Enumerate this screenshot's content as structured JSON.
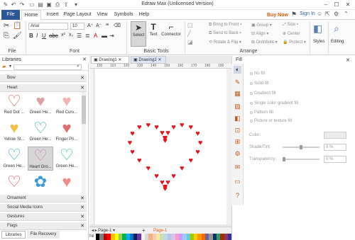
{
  "window": {
    "title": "Edraw Max (Unlicensed Version)"
  },
  "quickaccess": {
    "icons": [
      "undo-icon",
      "redo-icon",
      "new-icon",
      "open-icon",
      "save-icon",
      "print-icon",
      "export-icon"
    ]
  },
  "tabs": [
    "File",
    "Home",
    "Insert",
    "Page Layout",
    "View",
    "Symbols",
    "Help"
  ],
  "topright": {
    "buy_now": "Buy Now",
    "sign_in": "Sign In"
  },
  "ribbon": {
    "groups": {
      "file": "File",
      "font": "Font",
      "basic_tools": "Basic Tools",
      "arrange": "Arrange",
      "styles": "Styles",
      "editing": "Editing"
    },
    "font_name": "Arial",
    "font_size": "10",
    "tools": {
      "select": "Select",
      "text": "Text",
      "connector": "Connector"
    },
    "arrange": {
      "bring_to_front": "Bring to Front",
      "send_to_back": "Send to Back",
      "rotate_flip": "Rotate & Flip",
      "group": "Group",
      "align": "Align",
      "distribute": "Distribute",
      "size": "Size",
      "center": "Center",
      "protect": "Protect"
    }
  },
  "libraries": {
    "title": "Libraries",
    "categories": [
      "Bow",
      "Heart"
    ],
    "shapes": [
      {
        "label": "Red Dot ...",
        "glyph": "♡",
        "color": "#e85b5b"
      },
      {
        "label": "Green He...",
        "glyph": "♥",
        "color": "#e0a0a8"
      },
      {
        "label": "Red Curv...",
        "glyph": "♥",
        "color": "#f2b3b3"
      },
      {
        "label": "Yellow St...",
        "glyph": "♥",
        "color": "#f0c04a"
      },
      {
        "label": "Green He...",
        "glyph": "♡",
        "color": "#3bb0a0"
      },
      {
        "label": "Finger Pri...",
        "glyph": "♥",
        "color": "#e06a6a"
      },
      {
        "label": "Green He...",
        "glyph": "♡",
        "color": "#3aa5c8"
      },
      {
        "label": "Heart Gro...",
        "glyph": "♡",
        "color": "#d080b0"
      },
      {
        "label": "Green He...",
        "glyph": "♡",
        "color": "#30b8a8"
      },
      {
        "label": "",
        "glyph": "♡",
        "color": "#e04a5a"
      },
      {
        "label": "",
        "glyph": "✿",
        "color": "#3a9ad8"
      },
      {
        "label": "",
        "glyph": "♥",
        "color": "#f08a8a"
      }
    ],
    "bottom_categories": [
      "Ornament",
      "Social Media Icons",
      "Gestures",
      "Flags"
    ],
    "bottom_tabs": [
      "Libraries",
      "File Recovery"
    ]
  },
  "documents": {
    "tabs": [
      "Drawing1",
      "Drawing2"
    ],
    "ruler_marks": [
      "100",
      "110",
      "120",
      "130",
      "140",
      "150",
      "160",
      "170",
      "180",
      "190"
    ]
  },
  "pages": {
    "current": "Page-1",
    "active": "Page-1",
    "fill_label": "Fill"
  },
  "fill_panel": {
    "title": "Fill",
    "options": [
      "No fill",
      "Solid fill",
      "Gradient fill",
      "Single color gradient fill",
      "Pattern fill",
      "Picture or texture fill"
    ],
    "color_label": "Color:",
    "shade_label": "Shade/Tint:",
    "shade_value": "0 %",
    "transparency_label": "Transparency:",
    "transparency_value": "0 %"
  },
  "colors": {
    "accent": "#2b5797",
    "heart": "#e3141b",
    "buy_now": "#e05a00"
  },
  "palette": [
    "#000000",
    "#7f7f7f",
    "#c00000",
    "#ff0000",
    "#ffc000",
    "#ffff00",
    "#92d050",
    "#00b050",
    "#00b0f0",
    "#0070c0",
    "#002060",
    "#7030a0",
    "#f2f2f2",
    "#d9d9d9",
    "#f4b183",
    "#f8cbad",
    "#ffe699",
    "#c5e0b4",
    "#bdd7ee",
    "#b4c7e7",
    "#d9c3e6",
    "#ff99cc",
    "#cc99ff",
    "#99ccff",
    "#66cccc",
    "#99cc00",
    "#ffcc00",
    "#ff9900",
    "#ff6600",
    "#666699",
    "#969696",
    "#003366",
    "#339966",
    "#993300",
    "#993366",
    "#333399"
  ]
}
